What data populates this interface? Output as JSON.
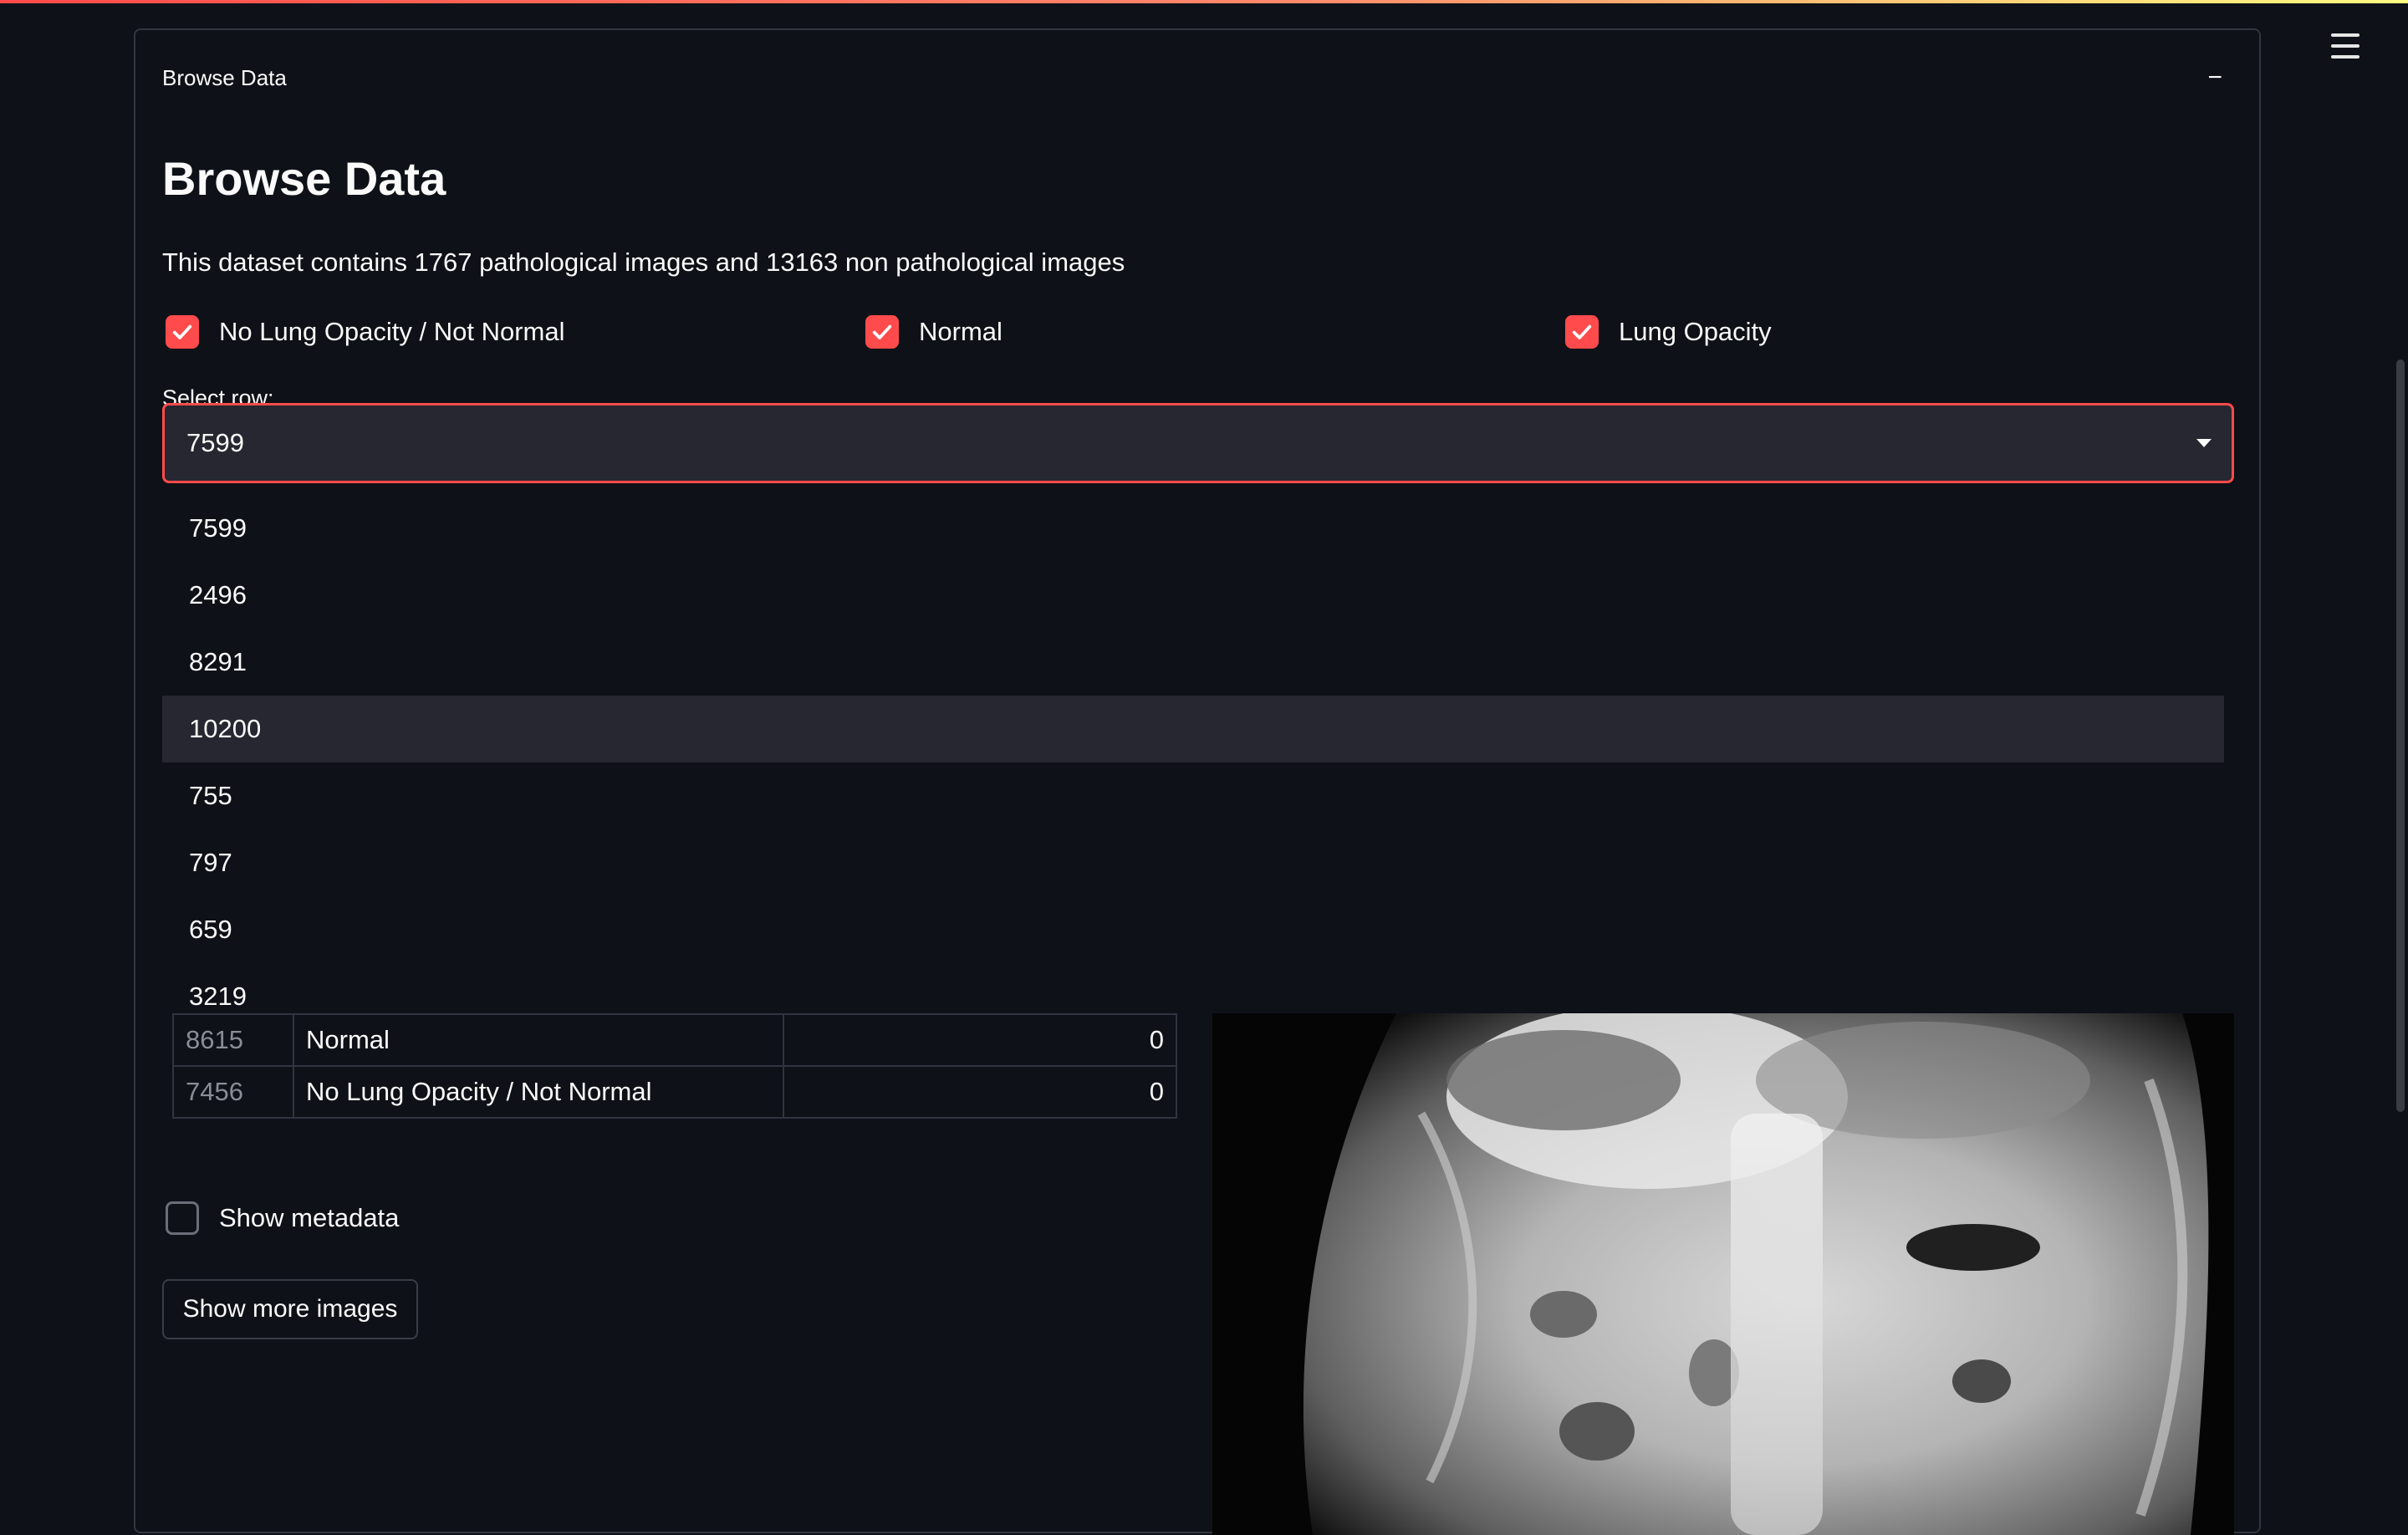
{
  "expander": {
    "header_label": "Browse Data",
    "collapse_symbol": "−"
  },
  "main": {
    "title": "Browse Data",
    "description": "This dataset contains 1767 pathological images and 13163 non pathological images"
  },
  "filters": [
    {
      "label": "No Lung Opacity / Not Normal",
      "checked": true
    },
    {
      "label": "Normal",
      "checked": true
    },
    {
      "label": "Lung Opacity",
      "checked": true
    }
  ],
  "select": {
    "label": "Select row:",
    "value": "7599",
    "options": [
      "7599",
      "2496",
      "8291",
      "10200",
      "755",
      "797",
      "659",
      "3219"
    ],
    "highlighted_option": "10200"
  },
  "table": {
    "rows": [
      {
        "index": "8615",
        "label": "Normal",
        "value": "0"
      },
      {
        "index": "7456",
        "label": "No Lung Opacity / Not Normal",
        "value": "0"
      }
    ]
  },
  "metadata": {
    "label": "Show metadata",
    "checked": false
  },
  "more_button": {
    "label": "Show more images"
  },
  "icons": {
    "menu": "hamburger-menu-icon",
    "check": "checkmark-icon",
    "dropdown": "caret-down-icon"
  },
  "colors": {
    "accent": "#ff4b4b",
    "background": "#0e1117",
    "input_bg": "#262730"
  }
}
